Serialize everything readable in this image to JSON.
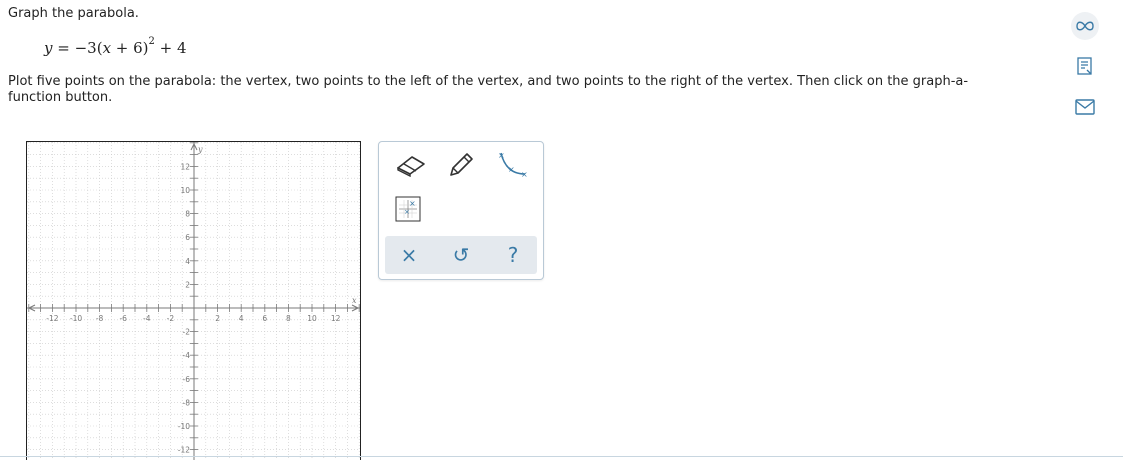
{
  "problem": {
    "title": "Graph the parabola.",
    "equation": {
      "lhs": "y",
      "eq": " = ",
      "a": "−3(",
      "var": "x",
      "inner": " + 6)",
      "exp": "2",
      "tail": " + 4"
    },
    "instructions": "Plot five points on the parabola: the vertex, two points to the left of the vertex, and two points to the right of the vertex. Then click on the graph-a-function button."
  },
  "graph": {
    "x_axis_label": "x",
    "y_axis_label": "y",
    "x_ticks": [
      "-12",
      "-10",
      "-8",
      "-6",
      "-4",
      "-2",
      "2",
      "4",
      "6",
      "8",
      "10",
      "12"
    ],
    "y_ticks": [
      "12",
      "10",
      "8",
      "6",
      "4",
      "2",
      "-2",
      "-4",
      "-6",
      "-8",
      "-10",
      "-12"
    ],
    "x_range": [
      -14,
      14
    ],
    "y_range": [
      -13,
      13
    ],
    "grid": true
  },
  "tools": {
    "eraser_icon": "eraser-icon",
    "pencil_icon": "pencil-icon",
    "curve_icon": "parabola-curve-icon",
    "graph_function_icon": "graph-a-function-icon",
    "clear_label": "×",
    "undo_label": "↺",
    "help_label": "?"
  },
  "side_icons": [
    "infinity-icon",
    "notes-icon",
    "mail-icon"
  ],
  "colors": {
    "accent": "#3a7aa6",
    "grid_line": "#c9c9c9",
    "axis": "#7a7a7a",
    "panel_bg": "#e4e9ee"
  }
}
